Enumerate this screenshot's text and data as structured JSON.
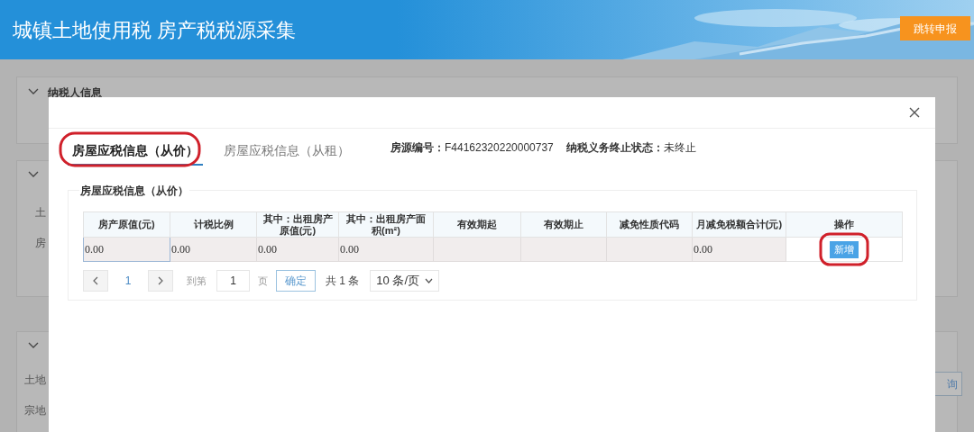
{
  "header": {
    "title": "城镇土地使用税 房产税税源采集",
    "button": "跳转申报"
  },
  "background": {
    "panel_title": "纳税人信息",
    "labels_1": [
      "土",
      "房"
    ],
    "labels_2": [
      "土地",
      "宗地"
    ],
    "button": "询"
  },
  "modal": {
    "tabs": [
      {
        "label": "房屋应税信息（从价）",
        "selected": true,
        "highlighted": true
      },
      {
        "label": "房屋应税信息（从租）",
        "selected": false,
        "highlighted": false
      }
    ],
    "info": [
      {
        "label": "房源编号：",
        "value": "F44162320220000737"
      },
      {
        "label": "纳税义务终止状态：",
        "value": "未终止"
      }
    ],
    "section_title": "房屋应税信息（从价）",
    "table": {
      "columns": [
        "房产原值(元)",
        "计税比例",
        "其中：出租房产原值(元)",
        "其中：出租房产面积(m²)",
        "有效期起",
        "有效期止",
        "减免性质代码",
        "月减免税额合计(元)",
        "操作"
      ],
      "rows": [
        {
          "cells": [
            {
              "value": "0.00",
              "focused": true
            },
            {
              "value": "0.00",
              "focused": false
            },
            {
              "value": "0.00",
              "focused": false
            },
            {
              "value": "0.00",
              "focused": false
            },
            {
              "focused": false
            },
            {
              "focused": false
            },
            {
              "focused": false
            },
            {
              "value": "0.00",
              "focused": false
            }
          ],
          "action": "新增",
          "action_highlighted": true
        }
      ]
    },
    "pagination": {
      "page": "1",
      "goto_label": "到第",
      "goto_value": "1",
      "page_unit": "页",
      "confirm": "确定",
      "total": "共 1 条",
      "page_size": "10 条/页"
    }
  }
}
